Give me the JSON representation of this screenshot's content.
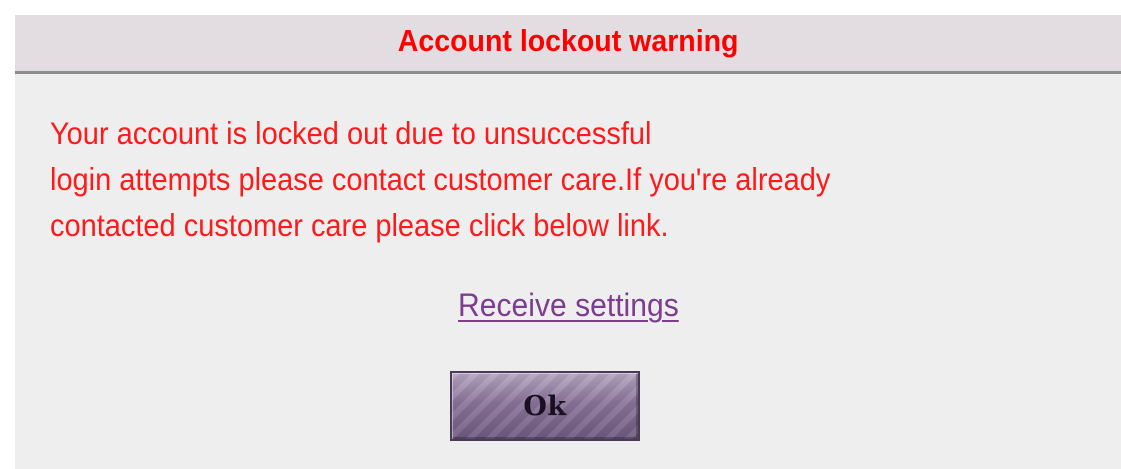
{
  "dialog": {
    "title": "Account lockout warning",
    "message_lines": [
      "Your account is locked out due to unsuccessful",
      "login attempts please contact customer care.If you're already",
      "contacted customer care please click below link."
    ],
    "link_label": "Receive settings",
    "ok_label": "Ok"
  },
  "colors": {
    "title_text": "#ff0000",
    "message_text": "#ff1a1a",
    "link_text": "#7d3c8f",
    "title_bar_bg": "#e3dde2",
    "dialog_bg": "#eeeeee",
    "button_bg": "#8a749a"
  }
}
